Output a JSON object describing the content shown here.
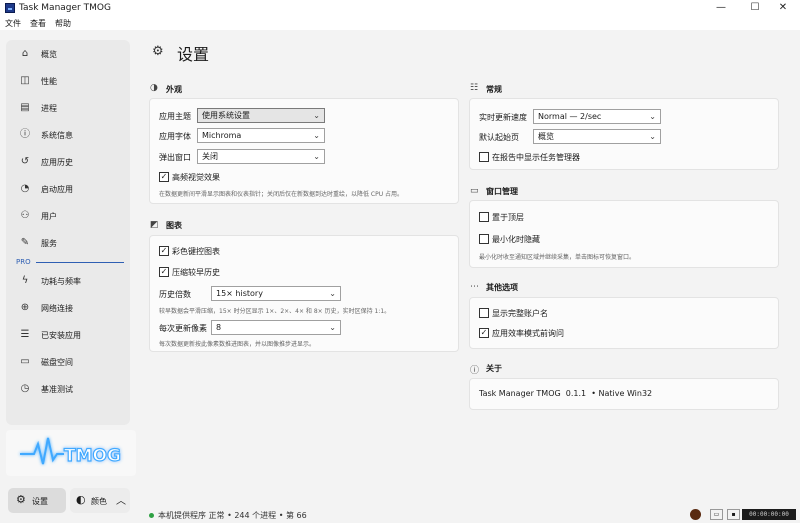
{
  "window": {
    "title": "Task Manager TMOG",
    "controls": {
      "minimize": "—",
      "maximize": "☐",
      "close": "✕"
    }
  },
  "menu": [
    "文件",
    "查看",
    "帮助"
  ],
  "sidebar": {
    "items": [
      {
        "label": "概览",
        "icon": "home-icon"
      },
      {
        "label": "性能",
        "icon": "performance-icon"
      },
      {
        "label": "进程",
        "icon": "processes-icon"
      },
      {
        "label": "系统信息",
        "icon": "info-icon"
      },
      {
        "label": "应用历史",
        "icon": "history-icon"
      },
      {
        "label": "启动应用",
        "icon": "startup-icon"
      },
      {
        "label": "用户",
        "icon": "users-icon"
      },
      {
        "label": "服务",
        "icon": "services-icon"
      }
    ],
    "pro_label": "PRO",
    "pro_items": [
      {
        "label": "功耗与频率",
        "icon": "power-icon"
      },
      {
        "label": "网络连接",
        "icon": "network-icon"
      },
      {
        "label": "已安装应用",
        "icon": "installed-apps-icon"
      },
      {
        "label": "磁盘空间",
        "icon": "disk-icon"
      },
      {
        "label": "基准测试",
        "icon": "benchmark-icon"
      }
    ],
    "logo_text": "TMOG",
    "settings_label": "设置",
    "color_label": "颜色"
  },
  "page": {
    "title": "设置"
  },
  "appearance": {
    "header": "外观",
    "theme_label": "应用主题",
    "theme_value": "使用系统设置",
    "font_label": "应用字体",
    "font_value": "Michroma",
    "popup_label": "弹出窗口",
    "popup_value": "关闭",
    "high_fps_label": "高频视觉效果",
    "high_fps_checked": true,
    "high_fps_desc": "在数据更新间平滑显示图表和仪表指针；关闭后仅在新数据到达时重绘，以降低 CPU 占用。"
  },
  "charts": {
    "header": "图表",
    "colored_label": "彩色键控图表",
    "colored_checked": true,
    "compress_label": "压缩较早历史",
    "compress_checked": true,
    "history_label": "历史倍数",
    "history_value": "15× history",
    "history_desc": "较早数据会平滑压缩，15× 时分区显示 1×、2×、4× 和 8× 历史，实时区保持 1:1。",
    "pixels_label": "每次更新像素",
    "pixels_value": "8",
    "pixels_desc": "每次数据更新按此像素数推进图表，并以图像推步进显示。"
  },
  "general": {
    "header": "常规",
    "refresh_label": "实时更新速度",
    "refresh_value": "Normal — 2/sec",
    "default_page_label": "默认起始页",
    "default_page_value": "概览",
    "show_in_tray_label": "在报告中显示任务管理器",
    "show_in_tray_checked": false
  },
  "window_mgmt": {
    "header": "窗口管理",
    "on_top_label": "置于顶层",
    "on_top_checked": false,
    "minimize_hide_label": "最小化时隐藏",
    "minimize_hide_checked": false,
    "minimize_hide_desc": "最小化时收至通知区域并继续采集，单击图标可恢复窗口。"
  },
  "other": {
    "header": "其他选项",
    "full_account_label": "显示完整账户名",
    "full_account_checked": false,
    "efficiency_label": "应用效率模式前询问",
    "efficiency_checked": true
  },
  "about": {
    "header": "关于",
    "text": "Task Manager TMOG  0.1.1  • Native Win32"
  },
  "status": {
    "text": "本机提供程序 正常 • 244 个进程 • 第 66",
    "clock": "00:00:00:00"
  },
  "colors": {
    "accent": "#2f5fb3",
    "status_ok": "#2ea043",
    "logo_glow": "#3fa9ff"
  }
}
